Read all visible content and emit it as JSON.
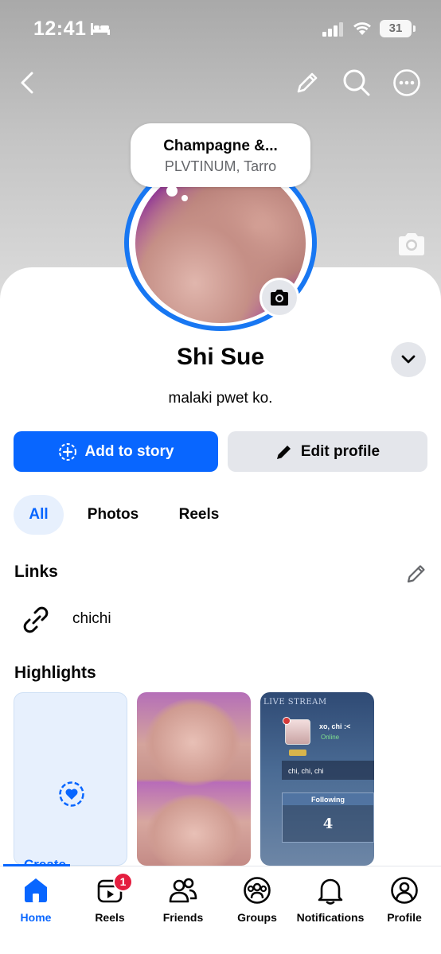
{
  "status_bar": {
    "time": "12:41",
    "battery": "31"
  },
  "top_nav": {
    "icons": [
      "back-icon",
      "pencil-icon",
      "search-icon",
      "more-icon"
    ]
  },
  "note": {
    "title": "Champagne &...",
    "subtitle": "PLVTINUM, Tarro"
  },
  "profile": {
    "name": "Shi Sue",
    "bio": "malaki pwet ko."
  },
  "actions": {
    "add_story": "Add to story",
    "edit_profile": "Edit profile"
  },
  "filters": {
    "all": "All",
    "photos": "Photos",
    "reels": "Reels"
  },
  "links": {
    "title": "Links",
    "items": [
      {
        "label": "chichi"
      }
    ]
  },
  "highlights": {
    "title": "Highlights",
    "create_label": "Create",
    "live_card": {
      "header": "LIVE STREAM",
      "user": "xo, chi :<",
      "status": "Online",
      "message": "chi, chi, chi",
      "following_label": "Following",
      "following_value": "4"
    }
  },
  "tabbar": {
    "active": "Home",
    "reels_badge": "1",
    "items": [
      {
        "label": "Home",
        "icon": "home-icon"
      },
      {
        "label": "Reels",
        "icon": "reels-icon"
      },
      {
        "label": "Friends",
        "icon": "friends-icon"
      },
      {
        "label": "Groups",
        "icon": "groups-icon"
      },
      {
        "label": "Notifications",
        "icon": "bell-icon"
      },
      {
        "label": "Profile",
        "icon": "profile-icon"
      }
    ]
  },
  "colors": {
    "accent": "#0866ff",
    "ring": "#1877f2",
    "badge": "#e41e3f",
    "chip_bg": "#e7f0fd",
    "button_gray": "#e4e6eb"
  }
}
